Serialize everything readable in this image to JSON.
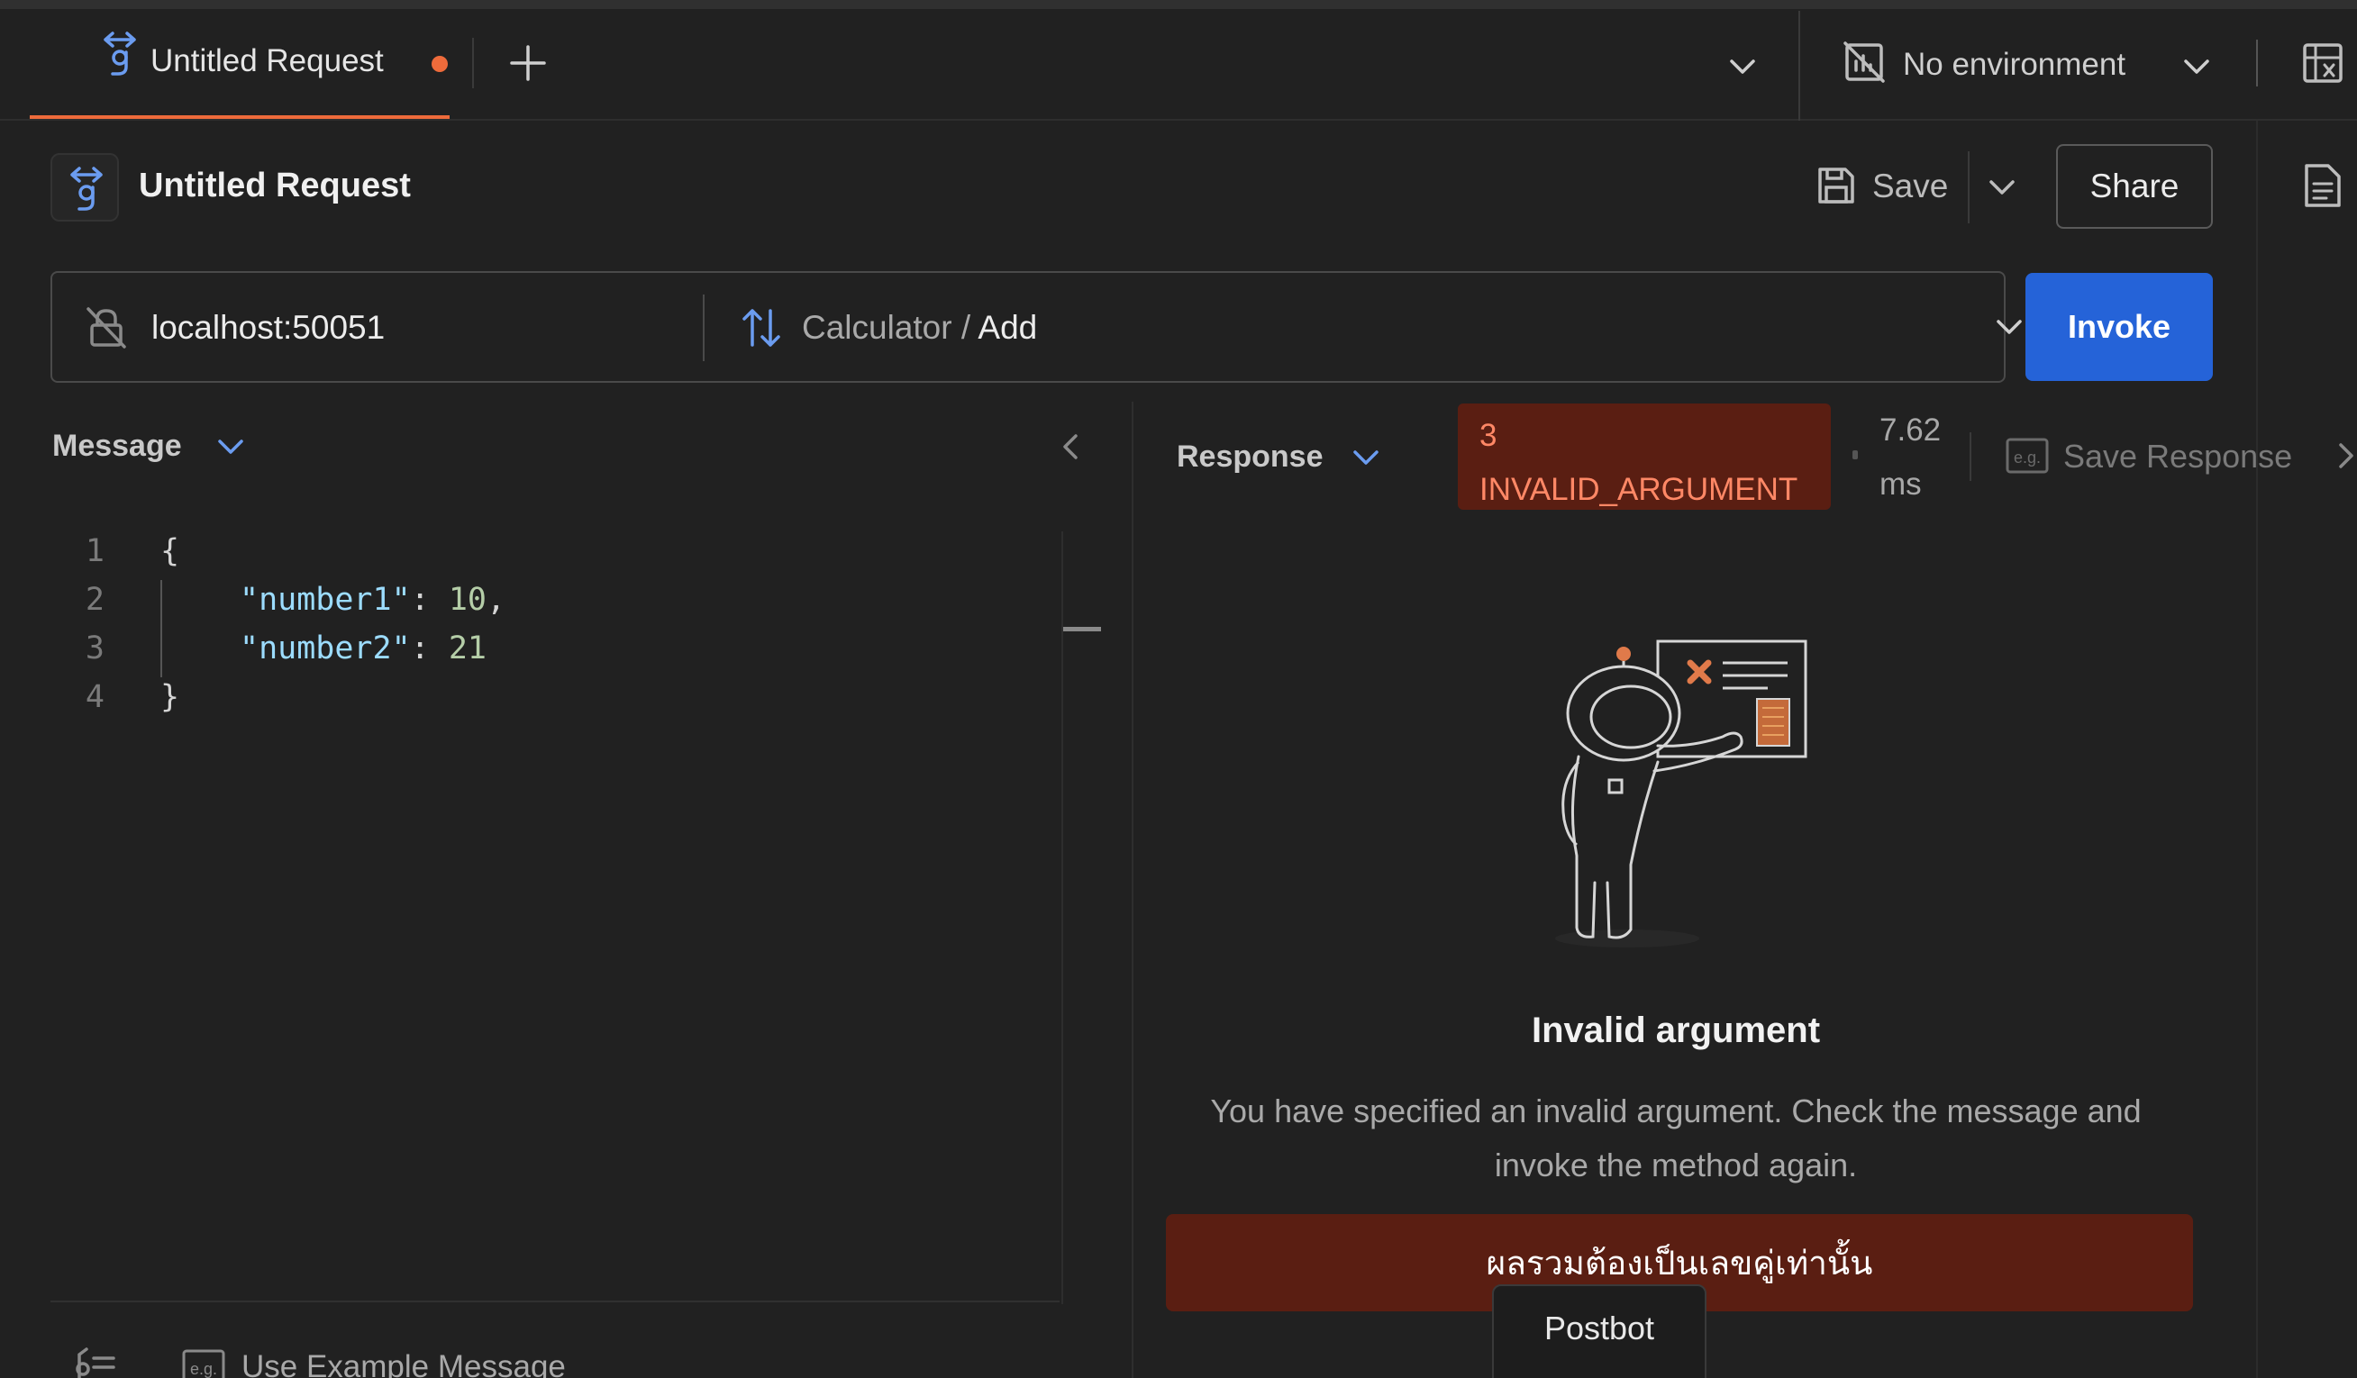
{
  "tabs": {
    "active_title": "Untitled Request",
    "environment_label": "No environment"
  },
  "header": {
    "title": "Untitled Request",
    "save_label": "Save",
    "share_label": "Share"
  },
  "urlbar": {
    "host": "localhost:50051",
    "service": "Calculator",
    "separator": "/",
    "method": "Add",
    "invoke_label": "Invoke"
  },
  "message": {
    "label": "Message",
    "lines": [
      {
        "no": "1",
        "text": "{"
      },
      {
        "no": "2",
        "key": "\"number1\"",
        "value": "10",
        "trail": ","
      },
      {
        "no": "3",
        "key": "\"number2\"",
        "value": "21",
        "trail": ""
      },
      {
        "no": "4",
        "text": "}"
      }
    ],
    "example_label": "Use Example Message"
  },
  "response": {
    "label": "Response",
    "status_code": "3",
    "status_name": "INVALID_ARGUMENT",
    "time_value": "7.62",
    "time_unit": "ms",
    "save_label": "Save Response",
    "error_title": "Invalid argument",
    "error_desc_line1": "You have specified an invalid argument. Check the message and",
    "error_desc_line2": "invoke the method again.",
    "error_detail": "ผลรวมต้องเป็นเลขคู่เท่านั้น"
  },
  "postbot": {
    "label": "Postbot"
  },
  "colors": {
    "background": "#212121",
    "accent": "#ee6b3b",
    "invoke": "#2563d8",
    "error_bg": "#5a1e12",
    "error_text": "#ff8866",
    "grpc_icon": "#6b9cf0"
  },
  "icons": [
    "grpc-icon",
    "plus-icon",
    "chevron-down-icon",
    "no-environment-icon",
    "environment-quicklook-icon",
    "save-icon",
    "documentation-icon",
    "tls-off-icon",
    "method-arrows-icon",
    "chevron-left-icon",
    "example-icon",
    "beautify-icon",
    "astronaut-illustration"
  ]
}
